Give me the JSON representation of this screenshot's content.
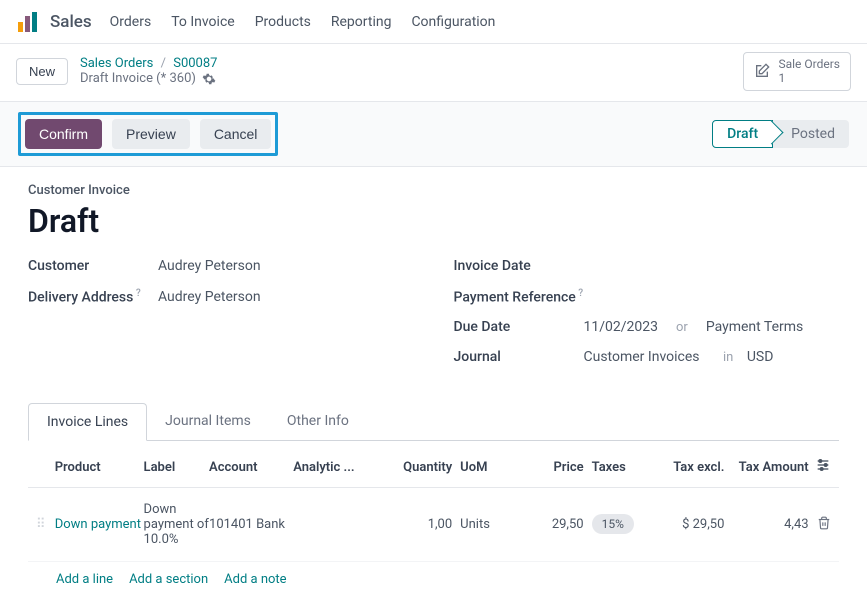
{
  "app": {
    "title": "Sales"
  },
  "nav": {
    "items": [
      "Orders",
      "To Invoice",
      "Products",
      "Reporting",
      "Configuration"
    ]
  },
  "subheader": {
    "new_btn": "New",
    "breadcrumb_root": "Sales Orders",
    "breadcrumb_sep": "/",
    "breadcrumb_order": "S00087",
    "draft_line": "Draft Invoice (* 360)",
    "sale_orders_label": "Sale Orders",
    "sale_orders_count": "1"
  },
  "actions": {
    "confirm": "Confirm",
    "preview": "Preview",
    "cancel": "Cancel"
  },
  "status": {
    "draft": "Draft",
    "posted": "Posted"
  },
  "form": {
    "section_label": "Customer Invoice",
    "title": "Draft",
    "customer_label": "Customer",
    "customer_value": "Audrey Peterson",
    "delivery_label": "Delivery Address",
    "delivery_value": "Audrey Peterson",
    "invoice_date_label": "Invoice Date",
    "payment_ref_label": "Payment Reference",
    "due_date_label": "Due Date",
    "due_date_value": "11/02/2023",
    "or_text": "or",
    "payment_terms": "Payment Terms",
    "journal_label": "Journal",
    "journal_value": "Customer Invoices",
    "in_text": "in",
    "currency": "USD"
  },
  "tabs": {
    "invoice_lines": "Invoice Lines",
    "journal_items": "Journal Items",
    "other_info": "Other Info"
  },
  "table": {
    "headers": {
      "product": "Product",
      "label": "Label",
      "account": "Account",
      "analytic": "Analytic ...",
      "quantity": "Quantity",
      "uom": "UoM",
      "price": "Price",
      "taxes": "Taxes",
      "tax_excl": "Tax excl.",
      "tax_amount": "Tax Amount"
    },
    "rows": [
      {
        "product": "Down payment",
        "label": "Down payment of 10.0%",
        "account": "101401 Bank",
        "analytic": "",
        "quantity": "1,00",
        "uom": "Units",
        "price": "29,50",
        "taxes": "15%",
        "tax_excl": "$ 29,50",
        "tax_amount": "4,43"
      }
    ]
  },
  "add_links": {
    "line": "Add a line",
    "section": "Add a section",
    "note": "Add a note"
  }
}
